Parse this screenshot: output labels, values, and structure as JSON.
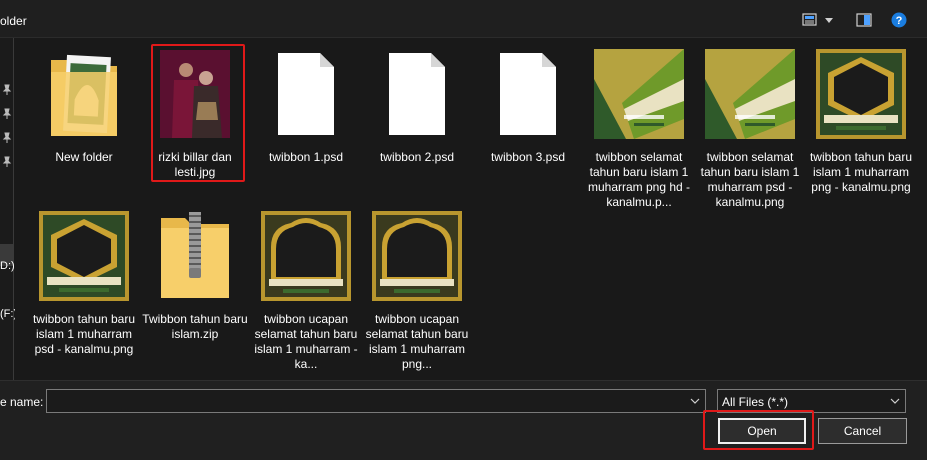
{
  "window": {
    "title": "older"
  },
  "toolbar": {
    "view_icon": "view-details-icon",
    "pane_icon": "preview-pane-icon",
    "help_icon": "help-icon"
  },
  "nav": {
    "labels": [
      "D:)",
      "(F:)"
    ]
  },
  "files": [
    {
      "name": "New folder",
      "kind": "folder"
    },
    {
      "name": "rizki billar dan lesti.jpg",
      "kind": "photo",
      "selected": true
    },
    {
      "name": "twibbon 1.psd",
      "kind": "blank"
    },
    {
      "name": "twibbon 2.psd",
      "kind": "blank"
    },
    {
      "name": "twibbon 3.psd",
      "kind": "blank"
    },
    {
      "name": "twibbon selamat tahun baru islam 1 muharram png hd - kanalmu.p...",
      "kind": "green-frame"
    },
    {
      "name": "twibbon selamat tahun baru islam 1 muharram psd - kanalmu.png",
      "kind": "green-frame"
    },
    {
      "name": "twibbon tahun baru islam 1 muharram png - kanalmu.png",
      "kind": "ornate"
    },
    {
      "name": "twibbon tahun baru islam 1 muharram psd - kanalmu.png",
      "kind": "ornate"
    },
    {
      "name": "Twibbon tahun baru islam.zip",
      "kind": "zip"
    },
    {
      "name": "twibbon ucapan selamat tahun baru islam 1 muharram - ka...",
      "kind": "dome"
    },
    {
      "name": "twibbon ucapan selamat tahun baru islam 1 muharram png...",
      "kind": "dome"
    }
  ],
  "bottom": {
    "file_name_label": "e name:",
    "file_name_value": "",
    "file_type": "All Files (*.*)",
    "open_label": "Open",
    "cancel_label": "Cancel"
  },
  "colors": {
    "highlight": "#e01919",
    "background": "#191919"
  }
}
